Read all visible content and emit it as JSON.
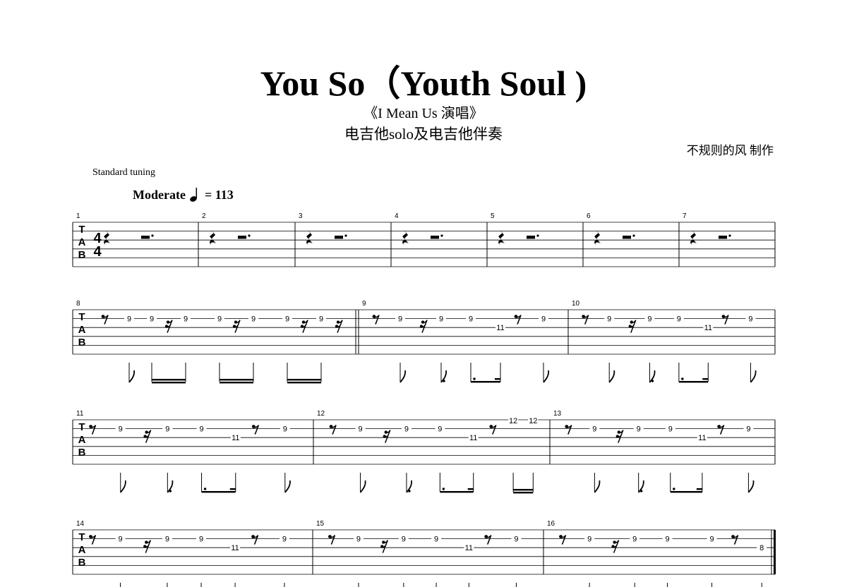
{
  "header": {
    "title": "You So（Youth Soul )",
    "subtitle": "《I  Mean  Us 演唱》",
    "instrument": "电吉他solo及电吉他伴奏",
    "author": "不规则的风 制作",
    "tuning": "Standard tuning",
    "tempo_label": "Moderate",
    "tempo_equals": "= 113",
    "tempo_note_icon": "quarter-note-icon"
  },
  "tab_clef": [
    "T",
    "A",
    "B"
  ],
  "time_signature": {
    "top": "4",
    "bottom": "4"
  },
  "systems": [
    {
      "measures": [
        {
          "number": "1",
          "type": "rest"
        },
        {
          "number": "2",
          "type": "rest"
        },
        {
          "number": "3",
          "type": "rest"
        },
        {
          "number": "4",
          "type": "rest"
        },
        {
          "number": "5",
          "type": "rest"
        },
        {
          "number": "6",
          "type": "rest"
        },
        {
          "number": "7",
          "type": "rest"
        }
      ]
    },
    {
      "measures": [
        {
          "number": "8",
          "type": "intro",
          "fret": "9"
        },
        {
          "number": "9",
          "type": "pattern",
          "fret": "9",
          "high": "11"
        },
        {
          "number": "10",
          "type": "pattern",
          "fret": "9",
          "high": "11"
        }
      ]
    },
    {
      "measures": [
        {
          "number": "11",
          "type": "pattern",
          "fret": "9",
          "high": "11"
        },
        {
          "number": "12",
          "type": "pattern_chord",
          "fret": "9",
          "high": "11",
          "chord": "12"
        },
        {
          "number": "13",
          "type": "pattern",
          "fret": "9",
          "high": "11"
        }
      ]
    },
    {
      "measures": [
        {
          "number": "14",
          "type": "pattern",
          "fret": "9",
          "high": "11"
        },
        {
          "number": "15",
          "type": "pattern",
          "fret": "9",
          "high": "11"
        },
        {
          "number": "16",
          "type": "pattern_end",
          "fret": "9",
          "high": "8"
        }
      ]
    }
  ]
}
